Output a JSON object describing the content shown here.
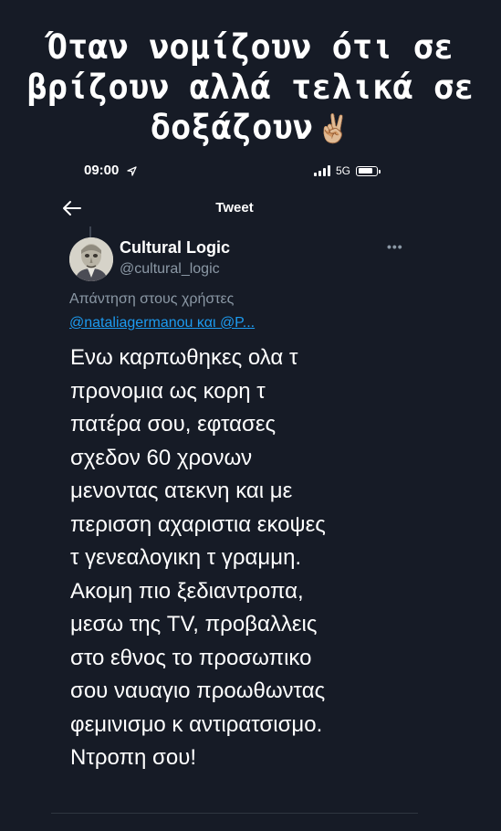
{
  "meme": {
    "title_lines": [
      "Όταν νομίζουν ότι σε",
      "βρίζουν αλλά τελικά σε",
      "δοξάζουν"
    ],
    "emoji": "✌🏼"
  },
  "status_bar": {
    "time": "09:00",
    "network": "5G"
  },
  "header": {
    "back_icon": "arrow-left-icon",
    "title": "Tweet"
  },
  "tweet": {
    "author_name": "Cultural Logic",
    "author_handle": "@cultural_logic",
    "reply_label": "Απάντηση στους χρήστες",
    "reply_mentions": "@nataliagermanou και @P...",
    "text_lines": [
      "Ενω καρπωθηκες ολα τ",
      "προνομια ως κορη τ",
      "πατέρα σου, εφτασες",
      "σχεδον 60 χρονων",
      "μενοντας ατεκνη και με",
      "περισση αχαριστια εκοψες",
      "τ γενεαλογικη τ γραμμη.",
      "Ακομη πιο ξεδιαντροπα,",
      "μεσω της TV, προβαλλεις",
      "στο εθνος το προσωπικο",
      "σου ναυαγιο προωθωντας",
      "φεμινισμο κ αντιρατσισμο.",
      "Ντροπη σου!"
    ]
  },
  "colors": {
    "background": "#161b26",
    "text": "#ffffff",
    "secondary": "#8b98a5",
    "link": "#1d9bf0"
  }
}
